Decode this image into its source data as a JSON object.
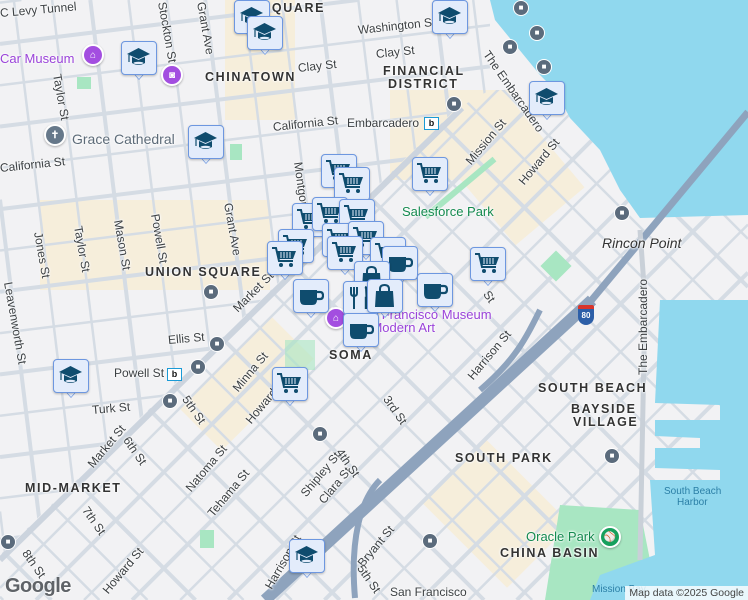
{
  "map": {
    "attribution": "Map data ©2025 Google",
    "logo": "Google",
    "colors": {
      "water": "#90d8ee",
      "land": "#f2f2f4",
      "park": "#a8e6c2",
      "marker_fill": "#e3ecfb",
      "marker_border": "#6d97e0",
      "icon": "#0f4c6e",
      "freeway": "#8ea3bd"
    },
    "labels": [
      "C Levy Tunnel",
      "Car Museum",
      "Taylor St",
      "Stockton St",
      "Grant Ave",
      "SQUARE",
      "CHINATOWN",
      "Clay St",
      "Washington St",
      "Clay St",
      "FINANCIAL",
      "DISTRICT",
      "California St",
      "Embarcadero",
      "Grace Cathedral",
      "California St",
      "Montgomery St",
      "The Embarcadero",
      "Mission St",
      "Howard St",
      "Salesforce Park",
      "Rincon Point",
      "Jones St",
      "Taylor St",
      "Mason St",
      "Powell St",
      "Grant Ave",
      "UNION SQUARE",
      "Leavenworth St",
      "Market St",
      "Ellis St",
      "Powell St",
      "Turk St",
      "5th St",
      "Minna St",
      "Howard St",
      "SOMA",
      "Market St",
      "6th St",
      "MID-MARKET",
      "7th St",
      "Natoma St",
      "Tehama St",
      "Shipley St",
      "Clara St",
      "4th St",
      "3rd St",
      "Harrison St",
      "SOUTH BEACH",
      "BAYSIDE",
      "VILLAGE",
      "SOUTH PARK",
      "The Embarcadero",
      "South Beach",
      "Harbor",
      "Oracle Park",
      "CHINA BASIN",
      "8th St",
      "Howard St",
      "Harrison St",
      "Bryant St",
      "5th St",
      "San Francisco",
      "San Francisco Museum",
      "of Modern Art",
      "St",
      "Mission Bay"
    ],
    "markers": [
      {
        "type": "school"
      },
      {
        "type": "school"
      },
      {
        "type": "school"
      },
      {
        "type": "school"
      },
      {
        "type": "school"
      },
      {
        "type": "school"
      },
      {
        "type": "school"
      },
      {
        "type": "school"
      },
      {
        "type": "grocery"
      },
      {
        "type": "grocery"
      },
      {
        "type": "grocery"
      },
      {
        "type": "grocery"
      },
      {
        "type": "grocery"
      },
      {
        "type": "grocery"
      },
      {
        "type": "grocery"
      },
      {
        "type": "grocery"
      },
      {
        "type": "grocery"
      },
      {
        "type": "grocery"
      },
      {
        "type": "grocery"
      },
      {
        "type": "grocery"
      },
      {
        "type": "grocery"
      },
      {
        "type": "grocery"
      },
      {
        "type": "cafe"
      },
      {
        "type": "cafe"
      },
      {
        "type": "shopping"
      },
      {
        "type": "restaurant"
      },
      {
        "type": "shopping"
      },
      {
        "type": "cafe"
      },
      {
        "type": "cafe"
      }
    ],
    "interstate": "80"
  }
}
